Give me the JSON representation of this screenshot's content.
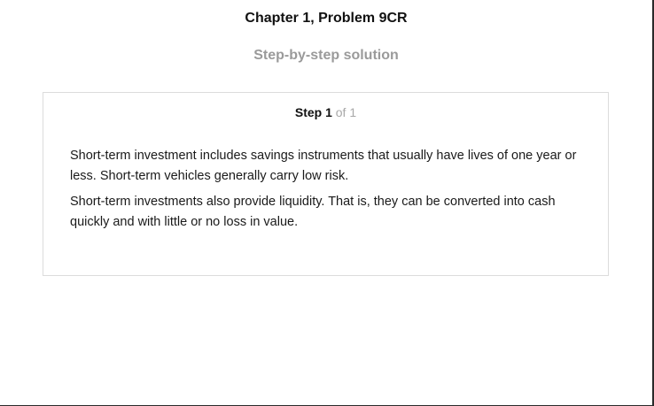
{
  "header": {
    "title": "Chapter 1, Problem 9CR",
    "subtitle": "Step-by-step solution"
  },
  "step": {
    "label": "Step 1",
    "of_text": "of 1",
    "paragraphs": [
      "Short-term investment includes savings instruments that usually have lives of one year or less. Short-term vehicles generally carry low risk.",
      "Short-term investments also provide liquidity. That is, they can be converted into cash quickly and with little or no loss in value."
    ]
  }
}
